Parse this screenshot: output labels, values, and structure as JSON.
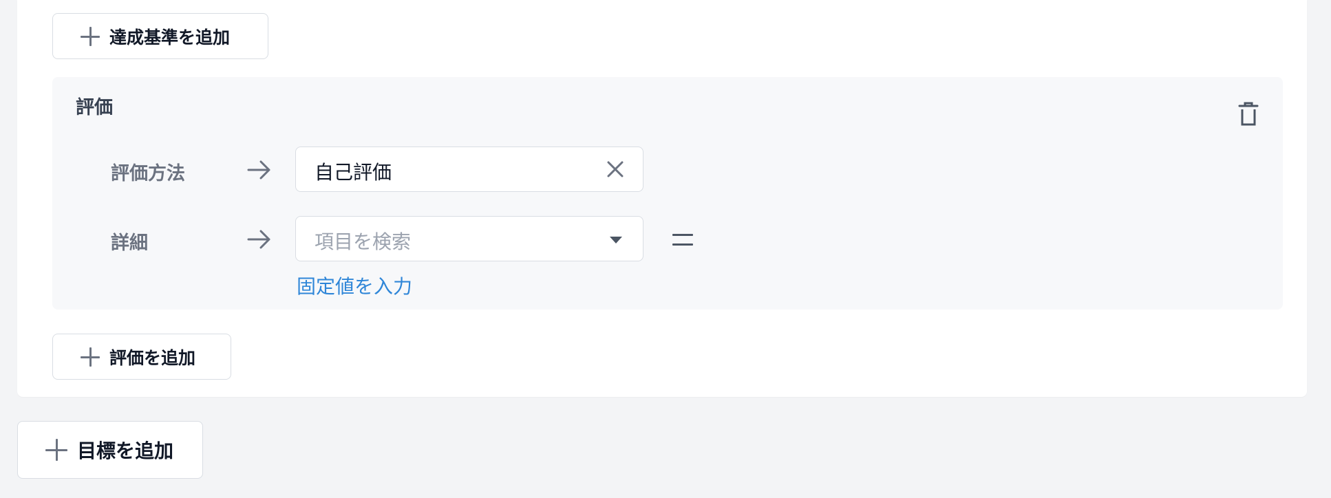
{
  "criteria": {
    "add_criterion_label": "達成基準を追加"
  },
  "evaluation": {
    "title": "評価",
    "method": {
      "label": "評価方法",
      "value": "自己評価"
    },
    "detail": {
      "label": "詳細",
      "placeholder": "項目を検索",
      "fixed_value_link": "固定値を入力"
    },
    "add_evaluation_label": "評価を追加"
  },
  "goal": {
    "add_goal_label": "目標を追加"
  },
  "icons": {
    "plus": "plus-icon",
    "trash": "trash-icon",
    "arrow": "arrow-right-icon",
    "clear": "close-icon",
    "caret": "chevron-down-icon",
    "equals": "equals-icon"
  },
  "colors": {
    "link": "#2f86d8",
    "section_bg": "#f7f8fa",
    "page_bg": "#f3f4f6"
  }
}
